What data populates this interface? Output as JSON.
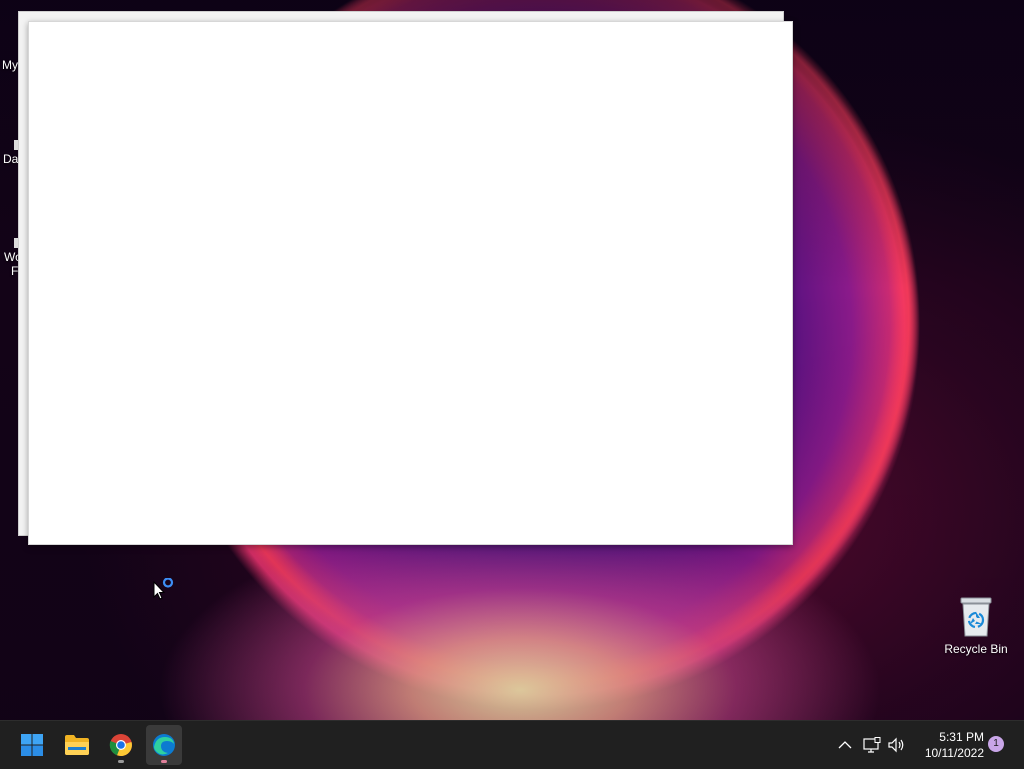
{
  "desktop": {
    "partial_icons": [
      {
        "label": "My"
      },
      {
        "label": "Da"
      },
      {
        "label": "Wo"
      },
      {
        "label": "F"
      }
    ],
    "recycle_bin": {
      "label": "Recycle Bin",
      "icon": "recycle-bin-icon"
    }
  },
  "windows": [
    {
      "name": "background-blank-window"
    },
    {
      "name": "foreground-blank-window"
    }
  ],
  "taskbar": {
    "apps": [
      {
        "name": "start-button",
        "icon": "windows-logo-icon"
      },
      {
        "name": "file-explorer",
        "icon": "folder-icon"
      },
      {
        "name": "chrome",
        "icon": "chrome-icon",
        "running": true
      },
      {
        "name": "edge",
        "icon": "edge-icon",
        "running": true,
        "active": true
      }
    ],
    "tray": {
      "icons": [
        "chevron-up-icon",
        "network-icon",
        "volume-icon"
      ],
      "time": "5:31 PM",
      "date": "10/11/2022",
      "notification_count": "1"
    }
  },
  "colors": {
    "taskbar_bg": "#202020",
    "accent_blue": "#0078d4"
  }
}
